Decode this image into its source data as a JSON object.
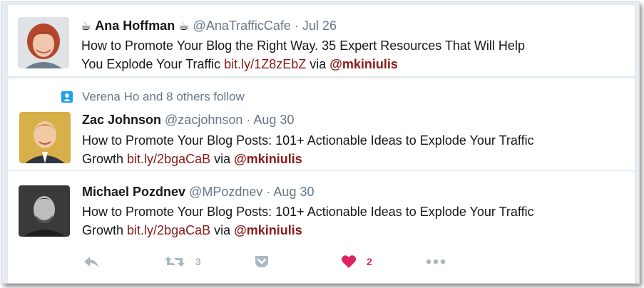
{
  "tweets": [
    {
      "name": "Ana Hoffman",
      "name_prefix_emoji": "☕",
      "name_suffix_emoji": "☕",
      "handle": "@AnaTrafficCafe",
      "separator": "·",
      "date": "Jul 26",
      "text_line1": "How to Promote Your Blog the Right Way. 35 Expert Resources That Will Help",
      "text_line2_prefix": "You Explode Your Traffic",
      "link": "bit.ly/1Z8zEbZ",
      "via": "via",
      "mention": "@mkiniulis",
      "avatar": "ana-hoffman-avatar"
    },
    {
      "context": "Verena Ho and 8 others follow",
      "context_icon": "follow-icon",
      "name": "Zac Johnson",
      "handle": "@zacjohnson",
      "separator": "·",
      "date": "Aug 30",
      "text_line1": "How to Promote Your Blog Posts: 101+ Actionable Ideas to Explode Your Traffic",
      "text_line2_prefix": "Growth",
      "link": "bit.ly/2bgaCaB",
      "via": "via",
      "mention": "@mkiniulis",
      "avatar": "zac-johnson-avatar"
    },
    {
      "name": "Michael Pozdnev",
      "handle": "@MPozdnev",
      "separator": "·",
      "date": "Aug 30",
      "text_line1": "How to Promote Your Blog Posts: 101+ Actionable Ideas to Explode Your Traffic",
      "text_line2_prefix": "Growth",
      "link": "bit.ly/2bgaCaB",
      "via": "via",
      "mention": "@mkiniulis",
      "avatar": "michael-pozdnev-avatar",
      "actions": {
        "reply_icon": "reply-icon",
        "retweet_icon": "retweet-icon",
        "retweet_count": "3",
        "pocket_icon": "pocket-icon",
        "like_icon": "heart-icon",
        "like_count": "2",
        "more_icon": "more-icon"
      }
    }
  ],
  "colors": {
    "link": "#8a1a1a",
    "secondary_text": "#657786",
    "like": "#e0245e",
    "action_gray": "#aab8c2",
    "background": "#e6ecf0"
  }
}
